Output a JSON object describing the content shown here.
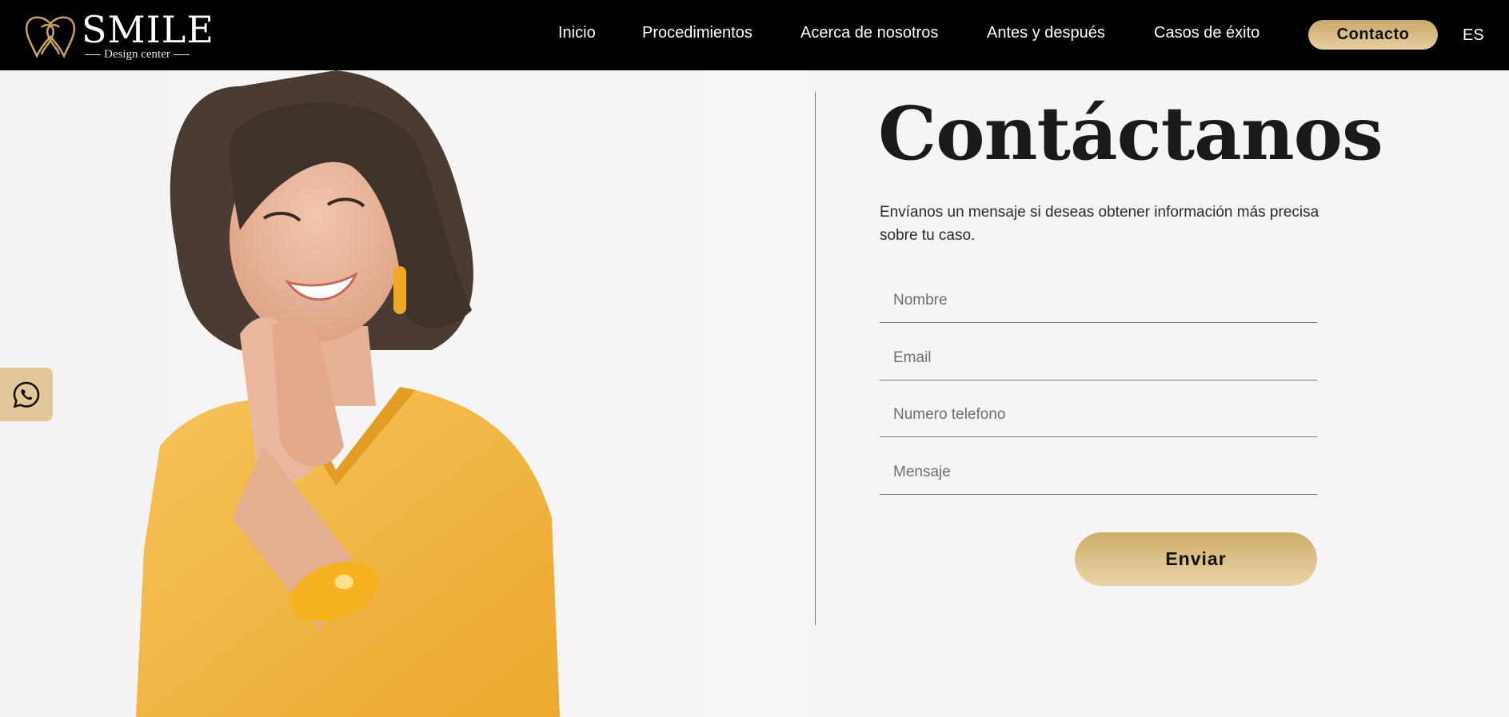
{
  "brand": {
    "name": "SMILE",
    "tagline": "Design center",
    "accent_color": "#d8bb82"
  },
  "nav": {
    "links": [
      {
        "label": "Inicio"
      },
      {
        "label": "Procedimientos"
      },
      {
        "label": "Acerca de nosotros"
      },
      {
        "label": "Antes y después"
      },
      {
        "label": "Casos de éxito"
      }
    ],
    "cta_label": "Contacto",
    "language": "ES"
  },
  "contact": {
    "heading": "Contáctanos",
    "intro": "Envíanos un mensaje si deseas obtener información más precisa sobre tu caso.",
    "fields": {
      "name_placeholder": "Nombre",
      "email_placeholder": "Email",
      "phone_placeholder": "Numero telefono",
      "message_placeholder": "Mensaje"
    },
    "submit_label": "Enviar"
  },
  "icons": {
    "logo": "tooth-heart-logo-icon",
    "whatsapp": "whatsapp-icon"
  }
}
